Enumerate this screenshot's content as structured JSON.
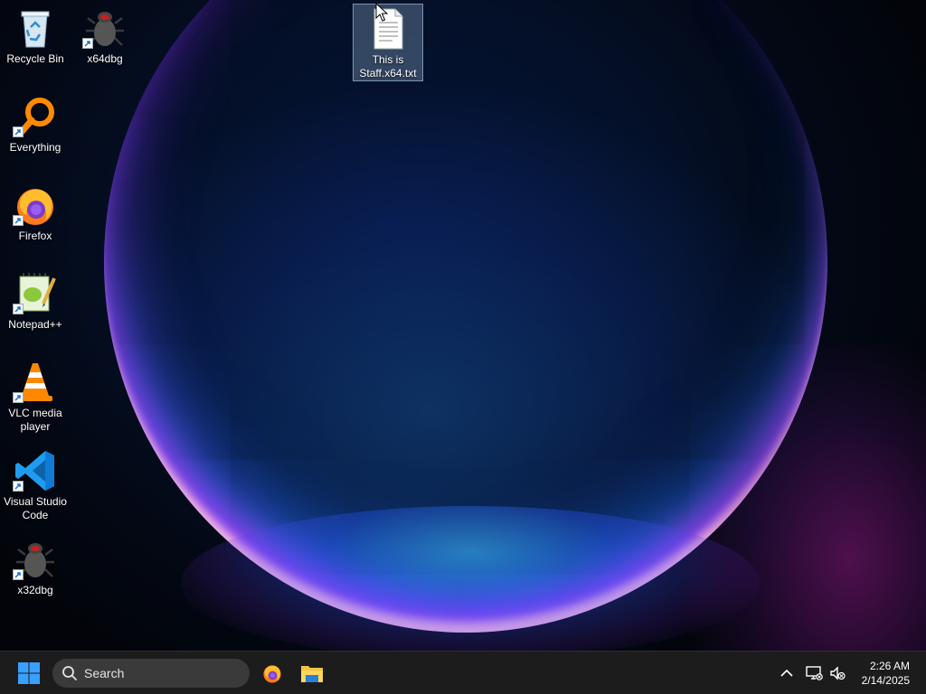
{
  "desktop": {
    "icons": [
      {
        "label": "Recycle Bin",
        "icon": "recycle-bin-icon"
      },
      {
        "label": "x64dbg",
        "icon": "x64dbg-bug-icon",
        "shortcut": true
      },
      {
        "label": "This is Staff.x64.txt",
        "icon": "text-file-icon",
        "selected": true
      },
      {
        "label": "Everything",
        "icon": "everything-magnifier-icon",
        "shortcut": true
      },
      {
        "label": "Firefox",
        "icon": "firefox-icon",
        "shortcut": true
      },
      {
        "label": "Notepad++",
        "icon": "notepad-plus-plus-icon",
        "shortcut": true
      },
      {
        "label": "VLC media player",
        "icon": "vlc-cone-icon",
        "shortcut": true
      },
      {
        "label": "Visual Studio Code",
        "icon": "vscode-icon",
        "shortcut": true
      },
      {
        "label": "x32dbg",
        "icon": "x32dbg-bug-icon",
        "shortcut": true
      }
    ]
  },
  "taskbar": {
    "search_placeholder": "Search",
    "pinned": [
      "firefox-icon",
      "file-explorer-icon"
    ],
    "tray": [
      "chevron-up-icon",
      "network-icon",
      "speaker-muted-icon"
    ],
    "clock": {
      "time": "2:26 AM",
      "date": "2/14/2025"
    }
  },
  "colors": {
    "taskbar_bg": "#1c1c1c",
    "search_bg": "#3a3a3a",
    "windows_blue": "#3aa0ff"
  }
}
